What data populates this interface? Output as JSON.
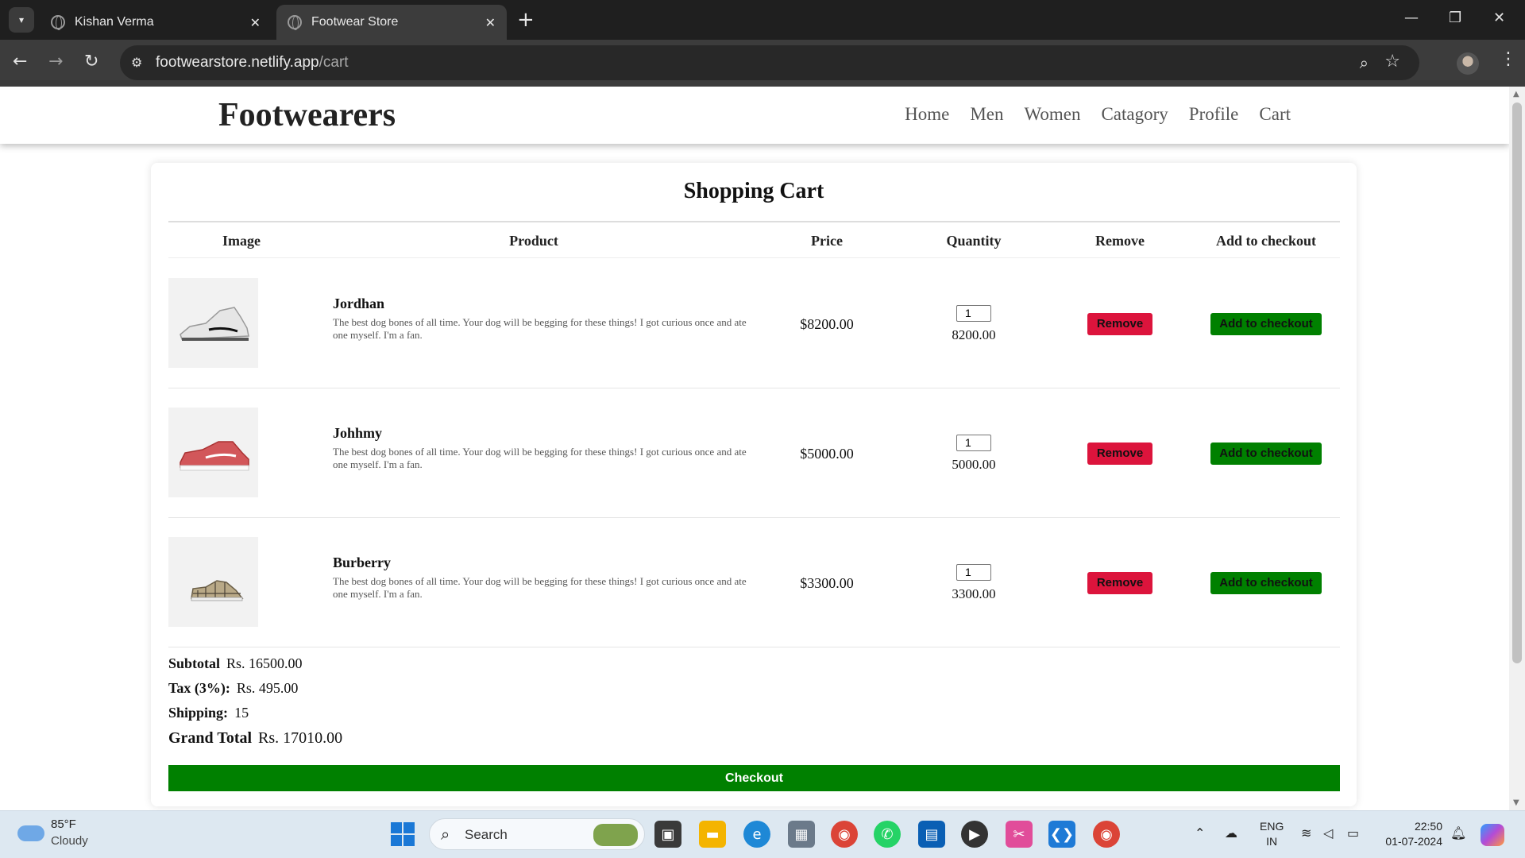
{
  "browser": {
    "tabs": [
      {
        "title": "Kishan Verma",
        "active": false
      },
      {
        "title": "Footwear Store",
        "active": true
      }
    ],
    "url_host": "footwearstore.netlify.app",
    "url_path": "/cart"
  },
  "site": {
    "brand": "Footwearers",
    "nav": [
      "Home",
      "Men",
      "Women",
      "Catagory",
      "Profile",
      "Cart"
    ]
  },
  "cart": {
    "title": "Shopping Cart",
    "columns": [
      "Image",
      "Product",
      "Price",
      "Quantity",
      "Remove",
      "Add to checkout"
    ],
    "items": [
      {
        "name": "Jordhan",
        "description": "The best dog bones of all time. Your dog will be begging for these things! I got curious once and ate one myself. I'm a fan.",
        "price": "$8200.00",
        "quantity": "1",
        "line_total": "8200.00",
        "image_icon": "white-sneaker-icon",
        "remove_label": "Remove",
        "add_label": "Add to checkout"
      },
      {
        "name": "Johhmy",
        "description": "The best dog bones of all time. Your dog will be begging for these things! I got curious once and ate one myself. I'm a fan.",
        "price": "$5000.00",
        "quantity": "1",
        "line_total": "5000.00",
        "image_icon": "red-sneaker-icon",
        "remove_label": "Remove",
        "add_label": "Add to checkout"
      },
      {
        "name": "Burberry",
        "description": "The best dog bones of all time. Your dog will be begging for these things! I got curious once and ate one myself. I'm a fan.",
        "price": "$3300.00",
        "quantity": "1",
        "line_total": "3300.00",
        "image_icon": "plaid-sneaker-icon",
        "remove_label": "Remove",
        "add_label": "Add to checkout"
      }
    ],
    "totals": {
      "subtotal_label": "Subtotal",
      "subtotal": "Rs. 16500.00",
      "tax_label": "Tax (3%):",
      "tax": "Rs. 495.00",
      "shipping_label": "Shipping:",
      "shipping": "15",
      "grand_label": "Grand Total",
      "grand": "Rs. 17010.00"
    },
    "checkout_label": "Checkout"
  },
  "taskbar": {
    "weather_temp": "85°F",
    "weather_cond": "Cloudy",
    "search_placeholder": "Search",
    "lang_1": "ENG",
    "lang_2": "IN",
    "time": "22:50",
    "date": "01-07-2024"
  },
  "colors": {
    "remove_btn": "#dc143c",
    "add_btn": "#008000",
    "checkout_btn": "#008000"
  }
}
